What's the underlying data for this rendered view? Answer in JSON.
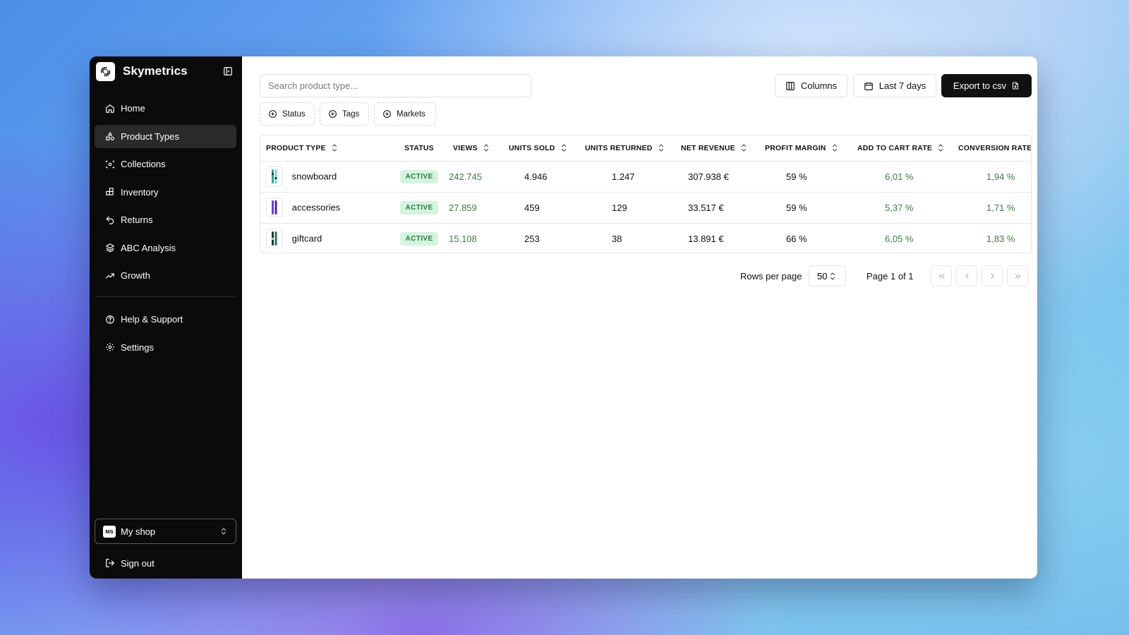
{
  "app": {
    "name": "Skymetrics"
  },
  "sidebar": {
    "items": [
      {
        "label": "Home",
        "icon": "home-icon"
      },
      {
        "label": "Product Types",
        "icon": "shapes-icon",
        "active": true
      },
      {
        "label": "Collections",
        "icon": "collection-icon"
      },
      {
        "label": "Inventory",
        "icon": "boxes-icon"
      },
      {
        "label": "Returns",
        "icon": "undo-icon"
      },
      {
        "label": "ABC Analysis",
        "icon": "layers-icon"
      },
      {
        "label": "Growth",
        "icon": "trending-up-icon"
      }
    ],
    "secondary": [
      {
        "label": "Help & Support",
        "icon": "help-circle-icon"
      },
      {
        "label": "Settings",
        "icon": "gear-icon"
      }
    ],
    "shop": {
      "initials": "MS",
      "name": "My shop"
    },
    "sign_out": "Sign out"
  },
  "toolbar": {
    "search_placeholder": "Search product type...",
    "columns_label": "Columns",
    "date_label": "Last 7 days",
    "export_label": "Export to csv"
  },
  "filters": {
    "status": "Status",
    "tags": "Tags",
    "markets": "Markets"
  },
  "table": {
    "headers": {
      "product_type": "PRODUCT TYPE",
      "status": "STATUS",
      "views": "VIEWS",
      "units_sold": "UNITS SOLD",
      "units_returned": "UNITS RETURNED",
      "net_revenue": "NET REVENUE",
      "profit_margin": "PROFIT MARGIN",
      "add_to_cart_rate": "ADD TO CART RATE",
      "conversion_rate": "CONVERSION RATE"
    },
    "rows": [
      {
        "product_type": "snowboard",
        "status": "ACTIVE",
        "views": "242.745",
        "units_sold": "4.946",
        "units_returned": "1.247",
        "net_revenue": "307.938 €",
        "profit_margin": "59 %",
        "add_to_cart_rate": "6,01 %",
        "conversion_rate": "1,94 %"
      },
      {
        "product_type": "accessories",
        "status": "ACTIVE",
        "views": "27.859",
        "units_sold": "459",
        "units_returned": "129",
        "net_revenue": "33.517 €",
        "profit_margin": "59 %",
        "add_to_cart_rate": "5,37 %",
        "conversion_rate": "1,71 %"
      },
      {
        "product_type": "giftcard",
        "status": "ACTIVE",
        "views": "15.108",
        "units_sold": "253",
        "units_returned": "38",
        "net_revenue": "13.891 €",
        "profit_margin": "66 %",
        "add_to_cart_rate": "6,05 %",
        "conversion_rate": "1,83 %"
      }
    ]
  },
  "pagination": {
    "rows_per_page_label": "Rows per page",
    "rows_per_page_value": "50",
    "page_label": "Page 1 of 1"
  },
  "colors": {
    "accent_green": "#3f7a47",
    "badge_bg": "#d4f4df",
    "sidebar_bg": "#0b0b0c"
  }
}
